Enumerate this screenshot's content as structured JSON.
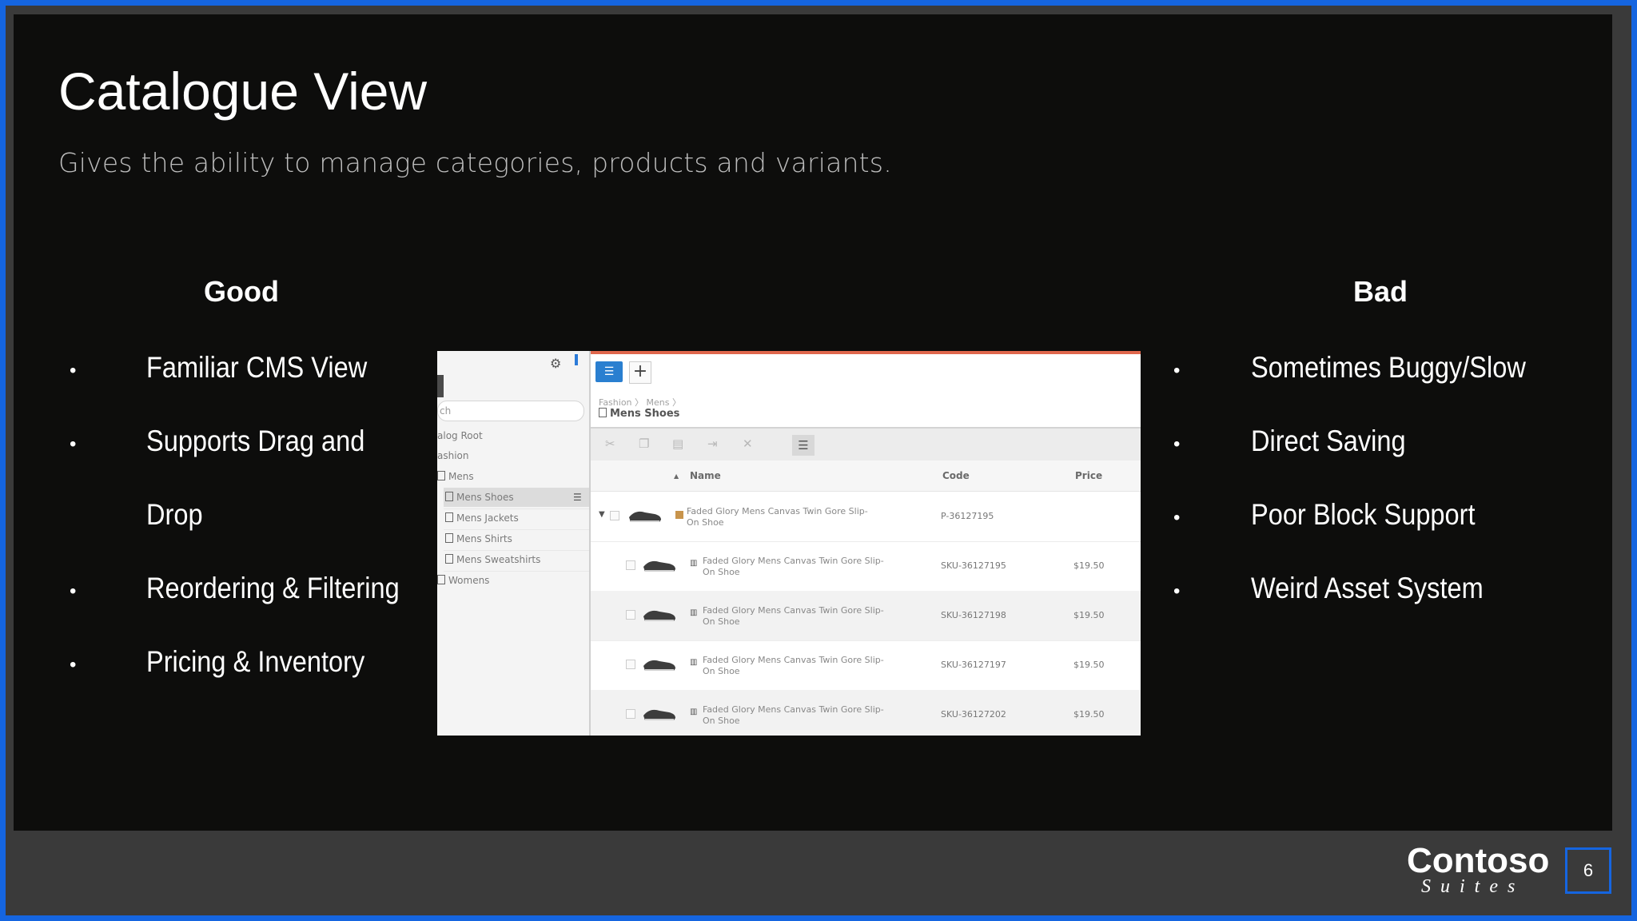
{
  "slide": {
    "title": "Catalogue View",
    "subtitle": "Gives the ability to manage categories, products and variants.",
    "good": {
      "heading": "Good",
      "items": [
        "Familiar CMS View",
        "Supports Drag and",
        "Drop",
        "Reordering & Filtering",
        "Pricing & Inventory"
      ]
    },
    "bad": {
      "heading": "Bad",
      "items": [
        "Sometimes Buggy/Slow",
        "Direct Saving",
        "Poor Block Support",
        "Weird Asset System"
      ]
    },
    "bullet_char": "•",
    "logo": {
      "line1": "Contoso",
      "line2": "Suites"
    },
    "page_number": "6"
  },
  "screenshot": {
    "search_placeholder": "ch",
    "tree": [
      {
        "label": "alog Root"
      },
      {
        "label": "ashion"
      },
      {
        "label": "Mens"
      },
      {
        "label": "Mens Shoes",
        "selected": true
      },
      {
        "label": "Mens Jackets"
      },
      {
        "label": "Mens Shirts"
      },
      {
        "label": "Mens Sweatshirts"
      },
      {
        "label": "Womens"
      }
    ],
    "breadcrumb": "Fashion 〉 Mens 〉",
    "folder_title": "Mens Shoes",
    "columns": {
      "sort": "▲",
      "name": "Name",
      "code": "Code",
      "price": "Price"
    },
    "rows": [
      {
        "name": "Faded Glory Mens Canvas Twin Gore Slip-On Shoe",
        "code": "P-36127195",
        "price": ""
      },
      {
        "name": "Faded Glory Mens Canvas Twin Gore Slip-On Shoe",
        "code": "SKU-36127195",
        "price": "$19.50"
      },
      {
        "name": "Faded Glory Mens Canvas Twin Gore Slip-On Shoe",
        "code": "SKU-36127198",
        "price": "$19.50"
      },
      {
        "name": "Faded Glory Mens Canvas Twin Gore Slip-On Shoe",
        "code": "SKU-36127197",
        "price": "$19.50"
      },
      {
        "name": "Faded Glory Mens Canvas Twin Gore Slip-On Shoe",
        "code": "SKU-36127202",
        "price": "$19.50"
      }
    ],
    "colors": {
      "accent": "#2a7fd0",
      "topline": "#e0674c"
    }
  }
}
